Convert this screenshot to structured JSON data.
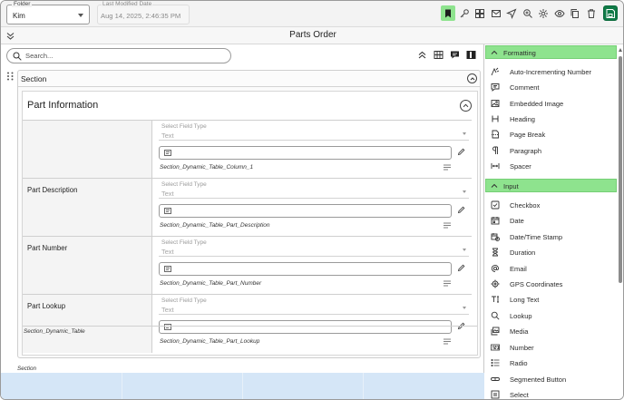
{
  "header": {
    "folder": {
      "label": "Folder",
      "value": "Kim"
    },
    "modified": {
      "label": "Last Modified Date",
      "value": "Aug 14, 2025, 2:46:35 PM"
    },
    "toolbar_icons": [
      "bookmark-icon",
      "key-icon",
      "puzzle-icon",
      "mail-icon",
      "share-icon",
      "zoom-icon",
      "gear-icon",
      "eye-icon",
      "copy-icon",
      "trash-icon",
      "save-icon"
    ]
  },
  "titlebar": {
    "title": "Parts Order"
  },
  "main": {
    "search_placeholder": "Search...",
    "section_label": "Section",
    "table": {
      "title": "Part Information",
      "rows": [
        {
          "label": "",
          "field_type_label": "Select Field Type",
          "field_type": "Text",
          "variable": "Section_Dynamic_Table_Column_1"
        },
        {
          "label": "Part Description",
          "field_type_label": "Select Field Type",
          "field_type": "Text",
          "variable": "Section_Dynamic_Table_Part_Description"
        },
        {
          "label": "Part Number",
          "field_type_label": "Select Field Type",
          "field_type": "Text",
          "variable": "Section_Dynamic_Table_Part_Number"
        },
        {
          "label": "Part Lookup",
          "field_type_label": "Select Field Type",
          "field_type": "Text",
          "variable": "Section_Dynamic_Table_Part_Lookup"
        }
      ],
      "footer": "Section_Dynamic_Table"
    },
    "section_footer": "Section"
  },
  "panel": {
    "formatting_label": "Formatting",
    "formatting_items": [
      {
        "label": "Auto-Incrementing Number",
        "icon": "auto-number-icon"
      },
      {
        "label": "Comment",
        "icon": "comment-icon"
      },
      {
        "label": "Embedded Image",
        "icon": "image-icon"
      },
      {
        "label": "Heading",
        "icon": "heading-icon"
      },
      {
        "label": "Page Break",
        "icon": "page-break-icon"
      },
      {
        "label": "Paragraph",
        "icon": "paragraph-icon"
      },
      {
        "label": "Spacer",
        "icon": "spacer-icon"
      }
    ],
    "input_label": "Input",
    "input_items": [
      {
        "label": "Checkbox",
        "icon": "checkbox-icon"
      },
      {
        "label": "Date",
        "icon": "date-icon"
      },
      {
        "label": "Date/Time Stamp",
        "icon": "datetime-icon"
      },
      {
        "label": "Duration",
        "icon": "hourglass-icon"
      },
      {
        "label": "Email",
        "icon": "at-icon"
      },
      {
        "label": "GPS Coordinates",
        "icon": "gps-icon"
      },
      {
        "label": "Long Text",
        "icon": "long-text-icon"
      },
      {
        "label": "Lookup",
        "icon": "lookup-icon"
      },
      {
        "label": "Media",
        "icon": "media-icon"
      },
      {
        "label": "Number",
        "icon": "number-icon"
      },
      {
        "label": "Radio",
        "icon": "radio-icon"
      },
      {
        "label": "Segmented Button",
        "icon": "segmented-icon"
      },
      {
        "label": "Select",
        "icon": "select-icon"
      }
    ]
  },
  "colors": {
    "accent_green": "#8ee38e",
    "save_green": "#0f7a47",
    "strip_blue": "#d5e6f7"
  }
}
